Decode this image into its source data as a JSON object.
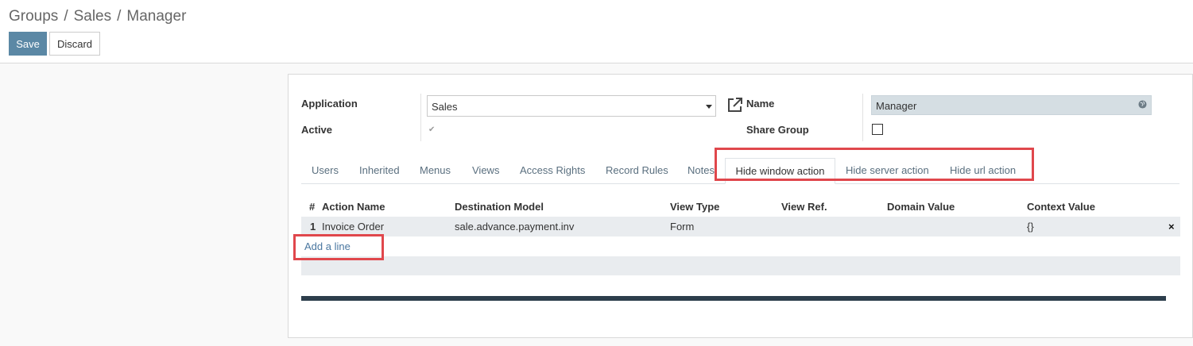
{
  "breadcrumb": {
    "items": [
      "Groups",
      "Sales",
      "Manager"
    ],
    "separator": "/"
  },
  "toolbar": {
    "save_label": "Save",
    "discard_label": "Discard"
  },
  "form": {
    "application_label": "Application",
    "application_value": "Sales",
    "active_label": "Active",
    "active_checked": true,
    "name_label": "Name",
    "name_value": "Manager",
    "share_group_label": "Share Group",
    "share_group_checked": false
  },
  "tabs": [
    {
      "label": "Users"
    },
    {
      "label": "Inherited"
    },
    {
      "label": "Menus"
    },
    {
      "label": "Views"
    },
    {
      "label": "Access Rights"
    },
    {
      "label": "Record Rules"
    },
    {
      "label": "Notes"
    },
    {
      "label": "Hide window action",
      "active": true
    },
    {
      "label": "Hide server action"
    },
    {
      "label": "Hide url action"
    }
  ],
  "table": {
    "columns": [
      "#",
      "Action Name",
      "Destination Model",
      "View Type",
      "View Ref.",
      "Domain Value",
      "Context Value"
    ],
    "rows": [
      {
        "num": "1",
        "action_name": "Invoice Order",
        "destination_model": "sale.advance.payment.inv",
        "view_type": "Form",
        "view_ref": "",
        "domain_value": "",
        "context_value": "{}"
      }
    ],
    "add_line_label": "Add a line",
    "delete_icon": "×"
  },
  "colors": {
    "accent": "#5b88a5",
    "highlight": "#e0474c",
    "link": "#4a77a0"
  },
  "icons": {
    "external_link": "external-link-icon",
    "globe": "globe-icon",
    "delete": "close-icon",
    "dropdown": "caret-down-icon"
  }
}
